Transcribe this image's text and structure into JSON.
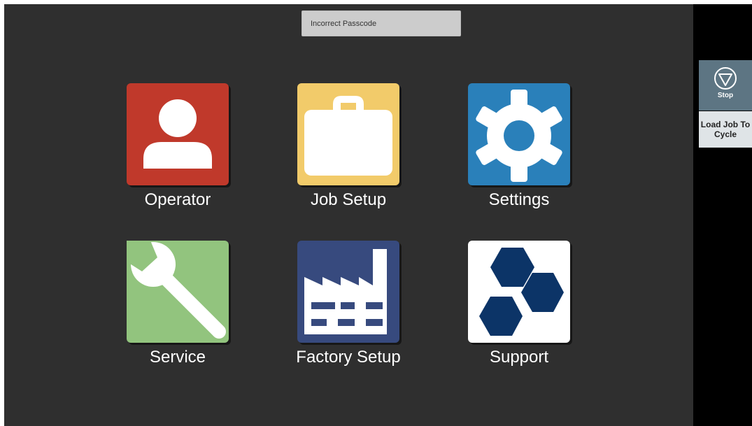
{
  "status_message": "Incorrect Passcode",
  "tiles": [
    {
      "label": "Operator",
      "icon": "person-icon",
      "color": "#c0392b"
    },
    {
      "label": "Job Setup",
      "icon": "briefcase-icon",
      "color": "#f2cb6a"
    },
    {
      "label": "Settings",
      "icon": "gear-icon",
      "color": "#2a80ba"
    },
    {
      "label": "Service",
      "icon": "wrench-icon",
      "color": "#92c47e"
    },
    {
      "label": "Factory Setup",
      "icon": "factory-icon",
      "color": "#374a7e"
    },
    {
      "label": "Support",
      "icon": "hexagons-icon",
      "color": "#ffffff"
    }
  ],
  "side_panel": {
    "stop_label": "Stop",
    "load_job_label": "Load Job To Cycle"
  }
}
